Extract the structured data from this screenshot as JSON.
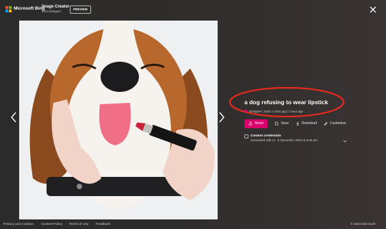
{
  "header": {
    "brand_label": "Microsoft Bing",
    "app_title": "Image Creator",
    "app_subtitle": "from Designer",
    "badge_label": "PREVIEW",
    "logo_colors": [
      "#f25022",
      "#7fba00",
      "#00a4ef",
      "#ffb900"
    ]
  },
  "image": {
    "icons": [
      "previous-arrow-icon",
      "next-arrow-icon",
      "close-icon"
    ]
  },
  "details": {
    "prompt": "a dog refusing to wear lipstick",
    "meta": "Designer | 1024 x 1024 jpg | 1 hour ago",
    "actions": {
      "share_label": "Share",
      "save_label": "Save",
      "download_label": "Download",
      "customize_label": "Customize"
    },
    "credentials_title": "Content credentials",
    "credentials_text": "Generated with AI · 6 December 2023 at 6:06 pm",
    "accent_color": "#d9006b",
    "highlight_color": "#e8291c"
  },
  "footer": {
    "links": [
      "Privacy and Cookies",
      "Content Policy",
      "Terms of Use",
      "Feedback"
    ],
    "copyright": "© 2023 Microsoft"
  }
}
